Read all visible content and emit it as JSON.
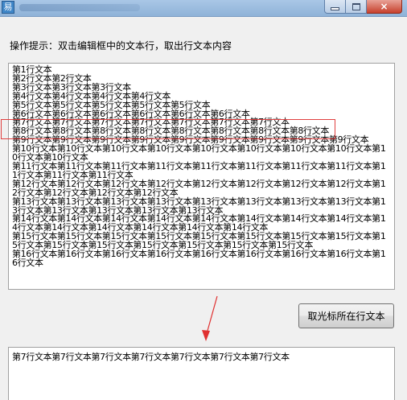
{
  "window": {
    "icon_glyph": "易",
    "minimize_icon": "minimize-icon",
    "maximize_icon": "maximize-icon",
    "close_glyph": "×"
  },
  "hint": "操作提示：双击编辑框中的文本行，取出行文本内容",
  "lines": [
    "第1行文本",
    "第2行文本第2行文本",
    "第3行文本第3行文本第3行文本",
    "第4行文本第4行文本第4行文本第4行文本",
    "第5行文本第5行文本第5行文本第5行文本第5行文本",
    "第6行文本第6行文本第6行文本第6行文本第6行文本第6行文本",
    "第7行文本第7行文本第7行文本第7行文本第7行文本第7行文本第7行文本",
    "第8行文本第8行文本第8行文本第8行文本第8行文本第8行文本第8行文本第8行文本",
    "第9行文本第9行文本第9行文本第9行文本第9行文本第9行文本第9行文本第9行文本第9行文本",
    "第10行文本第10行文本第10行文本第10行文本第10行文本第10行文本第10行文本第10行文本第10行文本第10行文本",
    "第11行文本第11行文本第11行文本第11行文本第11行文本第11行文本第11行文本第11行文本第11行文本第11行文本第11行文本",
    "第12行文本第12行文本第12行文本第12行文本第12行文本第12行文本第12行文本第12行文本第12行文本第12行文本第12行文本第12行文本",
    "第13行文本第13行文本第13行文本第13行文本第13行文本第13行文本第13行文本第13行文本第13行文本第13行文本第13行文本第13行文本第13行文本",
    "第14行文本第14行文本第14行文本第14行文本第14行文本第14行文本第14行文本第14行文本第14行文本第14行文本第14行文本第14行文本第14行文本第14行文本",
    "第15行文本第15行文本第15行文本第15行文本第15行文本第15行文本第15行文本第15行文本第15行文本第15行文本第15行文本第15行文本第15行文本第15行文本第15行文本",
    "第16行文本第16行文本第16行文本第16行文本第16行文本第16行文本第16行文本第16行文本第16行文本"
  ],
  "button_label": "取光标所在行文本",
  "result_text": "第7行文本第7行文本第7行文本第7行文本第7行文本第7行文本第7行文本",
  "colors": {
    "highlight": "#e04040",
    "arrow": "#e03030"
  }
}
